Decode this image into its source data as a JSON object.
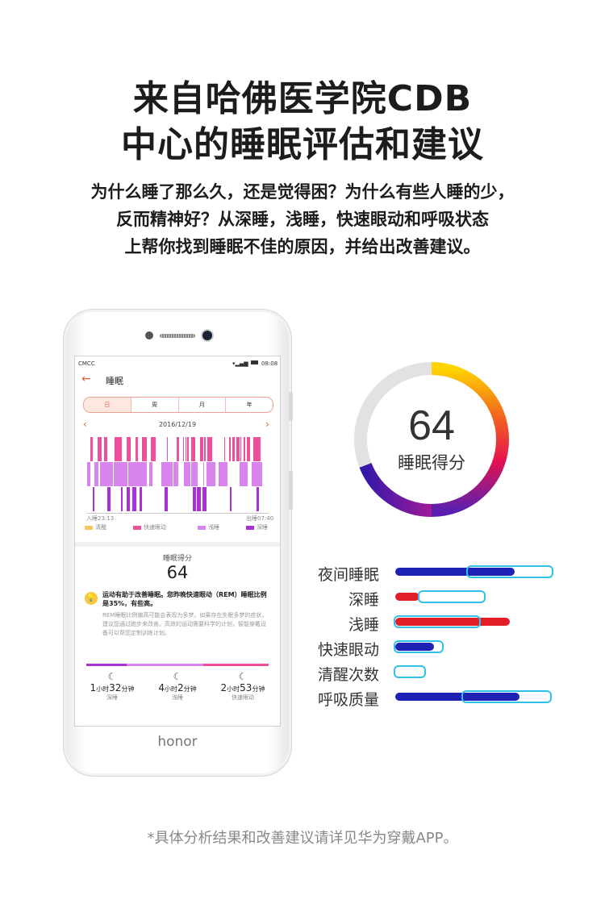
{
  "headline": {
    "line1": "来自哈佛医学院CDB",
    "line2": "中心的睡眠评估和建议"
  },
  "description": {
    "line1": "为什么睡了那么久，还是觉得困？为什么有些人睡的少，",
    "line2": "反而精神好？从深睡，浅睡，快速眼动和呼吸状态",
    "line3": "上帮你找到睡眠不佳的原因，并给出改善建议。"
  },
  "phone": {
    "brand": "honor",
    "status": {
      "carrier": "CMCC",
      "time": "08:08"
    },
    "header": {
      "title": "睡眠"
    },
    "tabs": [
      {
        "label": "日",
        "active": true
      },
      {
        "label": "周"
      },
      {
        "label": "月"
      },
      {
        "label": "年"
      }
    ],
    "date": "2016/12/19",
    "sleep_start": "入睡23:13",
    "sleep_end": "出睡07:40",
    "legend": [
      {
        "label": "清醒",
        "color": "#f5c65c"
      },
      {
        "label": "快速眼动",
        "color": "#ee4f9a"
      },
      {
        "label": "浅睡",
        "color": "#d883ee"
      },
      {
        "label": "深睡",
        "color": "#a832d6"
      }
    ],
    "score_label": "睡眠得分",
    "score_value": "64",
    "tip_title": "运动有助于改善睡眠。您昨晚快速眼动（REM）睡眠比例是35%，有些高。",
    "tip_body": "REM睡眠比例偏高可能会表现为多梦。如果存在失眠多梦的症状，建议您通过跑步来改善。高效的运动需要科学的计划，智能穿戴设备可以帮您定制训练计划。",
    "totals": [
      {
        "h": "1",
        "hu": "小时",
        "m": "32",
        "mu": "分钟",
        "label": "深睡"
      },
      {
        "h": "4",
        "hu": "小时",
        "m": "2",
        "mu": "分钟",
        "label": "浅睡"
      },
      {
        "h": "2",
        "hu": "小时",
        "m": "53",
        "mu": "分钟",
        "label": "快速眼动"
      }
    ]
  },
  "score_ring": {
    "value": "64",
    "label": "睡眠得分"
  },
  "metrics": [
    {
      "label": "夜间睡眠"
    },
    {
      "label": "深睡"
    },
    {
      "label": "浅睡"
    },
    {
      "label": "快速眼动"
    },
    {
      "label": "清醒次数"
    },
    {
      "label": "呼吸质量"
    }
  ],
  "colors": {
    "blue": "#1e22b4",
    "red": "#e41e26",
    "cyan": "#2fc2e8",
    "accent": "#e5603c"
  },
  "footnote": "*具体分析结果和改善建议请详见华为穿戴APP。"
}
